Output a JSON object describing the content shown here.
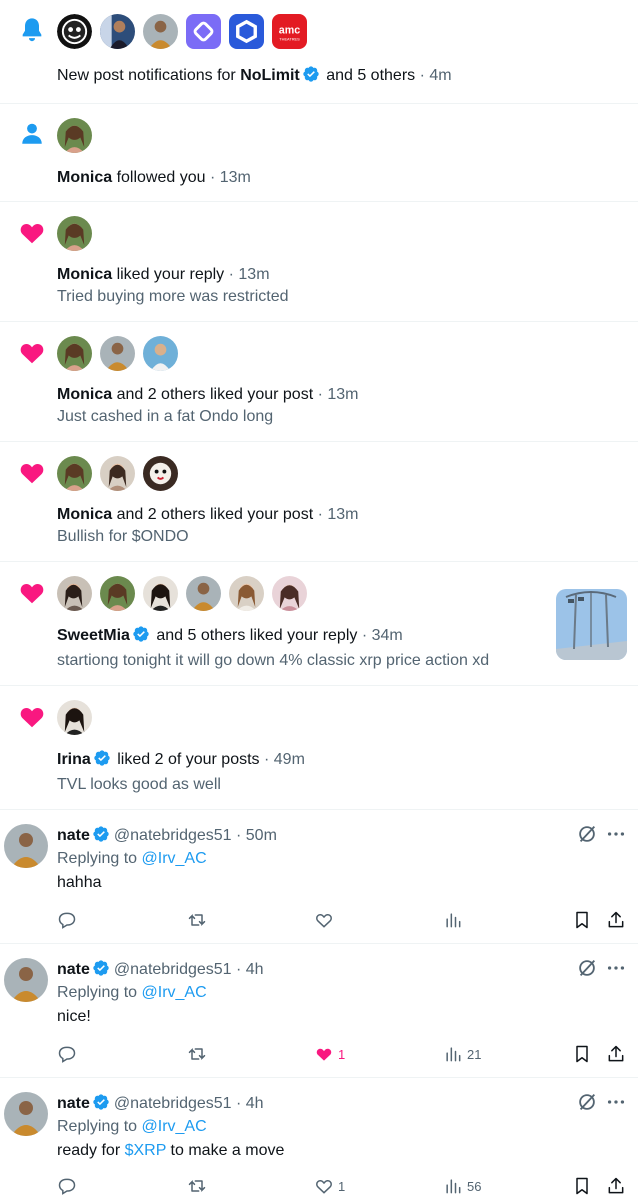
{
  "notifications": [
    {
      "kind": "bell-icon",
      "name": "NoLimit",
      "rest": " and 5 others",
      "time": " · 4m",
      "prefix": "New post notifications for ",
      "avatars": [
        "money-avatar",
        "person-avatar",
        "man-avatar",
        "diamond-logo",
        "chainlink-logo",
        "amc-logo"
      ],
      "amc_text": "amc",
      "amc_sub": "THEATRES"
    },
    {
      "kind": "person-icon",
      "name": "Monica",
      "rest": " followed you",
      "time": " · 13m"
    },
    {
      "kind": "heart-icon",
      "name": "Monica",
      "rest": " liked your reply",
      "time": " · 13m",
      "text": "Tried buying more was restricted"
    },
    {
      "kind": "heart-icon",
      "name": "Monica",
      "rest": " and 2 others liked your post",
      "time": " · 13m",
      "text": "Just cashed in a fat Ondo long"
    },
    {
      "kind": "heart-icon",
      "name": "Monica",
      "rest": " and 2 others liked your post",
      "time": " · 13m",
      "text": "Bullish for $ONDO"
    },
    {
      "kind": "heart-icon",
      "name": "SweetMia",
      "rest": " and 5 others liked your reply",
      "time": " · 34m",
      "text": "startiong tonight it will go down 4% classic xrp price action  xd"
    },
    {
      "kind": "heart-icon",
      "name": "Irina",
      "rest": " liked 2 of your posts",
      "time": " · 49m",
      "text": "TVL looks good as well"
    }
  ],
  "tweets": [
    {
      "name": "nate",
      "handle": "@natebridges51",
      "time": " · 50m",
      "replying": "Replying to ",
      "reply_to": "@Irv_AC",
      "text": "hahha",
      "likes": "",
      "views": ""
    },
    {
      "name": "nate",
      "handle": "@natebridges51",
      "time": " · 4h",
      "replying": "Replying to ",
      "reply_to": "@Irv_AC",
      "text": "nice!",
      "likes": "1",
      "views": "21"
    },
    {
      "name": "nate",
      "handle": "@natebridges51",
      "time": " · 4h",
      "replying": "Replying to ",
      "reply_to": "@Irv_AC",
      "text_before": "ready for ",
      "cashtag": "$XRP",
      "text_after": " to make a move",
      "likes": "1",
      "views": "56"
    }
  ],
  "colors": {
    "accent": "#1d9bf0",
    "like": "#f91880",
    "muted": "#536471",
    "text": "#0f1419"
  }
}
